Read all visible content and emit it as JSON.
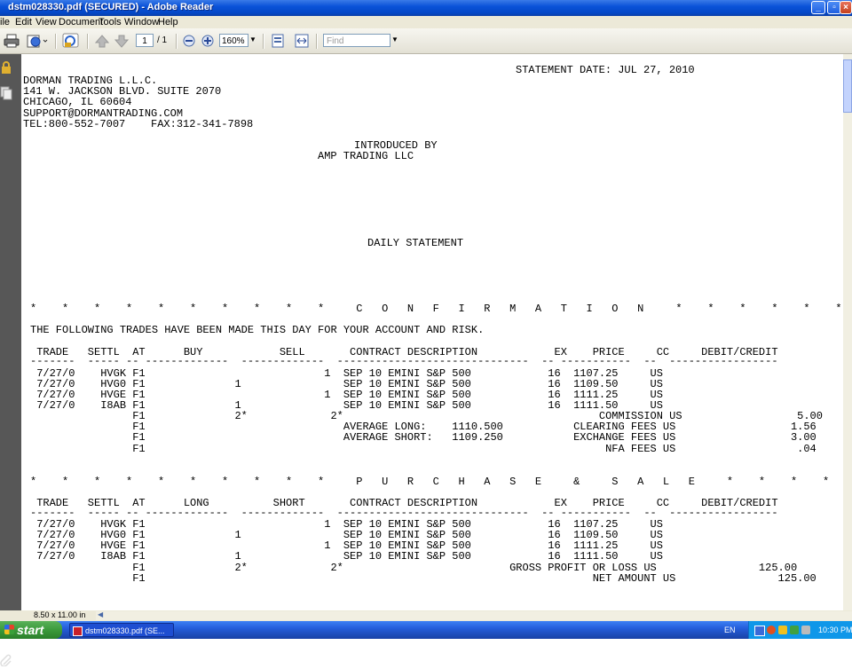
{
  "window": {
    "title": "dstm028330.pdf (SECURED) - Adobe Reader"
  },
  "menu": [
    "ile",
    "Edit",
    "View",
    "Document",
    "Tools",
    "Window",
    "Help"
  ],
  "toolbar": {
    "page_current": "1",
    "page_total": "/ 1",
    "zoom": "160%",
    "find_placeholder": "Find"
  },
  "document": {
    "statement_date": "STATEMENT DATE: JUL 27, 2010",
    "firm": {
      "name": "DORMAN TRADING L.L.C.",
      "address1": "141 W. JACKSON BLVD. SUITE 2070",
      "address2": "CHICAGO, IL 60604",
      "email": "SUPPORT@DORMANTRADING.COM",
      "phones": "TEL:800-552-7007    FAX:312-341-7898"
    },
    "introduced_by_label": "INTRODUCED BY",
    "introduced_by": "AMP TRADING LLC",
    "statement_type": "DAILY STATEMENT",
    "confirmation": {
      "banner": "*    *    *    *    *    *    *    *    *    *     C   O   N   F   I   R   M   A   T   I   O   N     *    *    *    *    *    *    *    *    *    *",
      "intro": "THE FOLLOWING TRADES HAVE BEEN MADE THIS DAY FOR YOUR ACCOUNT AND RISK.",
      "header": " TRADE   SETTL  AT      BUY            SELL       CONTRACT DESCRIPTION            EX    PRICE     CC     DEBIT/CREDIT",
      "rule": "-------  ----- -- -------------  -------------  ------------------------------  -- -----------  --  -----------------",
      "rows": [
        " 7/27/0    HVGK F1                            1  SEP 10 EMINI S&P 500            16  1107.25     US",
        " 7/27/0    HVG0 F1              1                SEP 10 EMINI S&P 500            16  1109.50     US",
        " 7/27/0    HVGE F1                            1  SEP 10 EMINI S&P 500            16  1111.25     US",
        " 7/27/0    I8AB F1              1                SEP 10 EMINI S&P 500            16  1111.50     US",
        "                F1              2*             2*                                        COMMISSION US                  5.00",
        "                F1                               AVERAGE LONG:    1110.500           CLEARING FEES US                  1.56",
        "                F1                               AVERAGE SHORT:   1109.250           EXCHANGE FEES US                  3.00",
        "                F1                                                                        NFA FEES US                   .04"
      ]
    },
    "purchase_sale": {
      "banner": "*    *    *    *    *    *    *    *    *    *     P   U   R   C   H   A   S   E     &     S   A   L   E     *    *    *    *    *    *    *    *    *    *",
      "header": " TRADE   SETTL  AT      LONG          SHORT       CONTRACT DESCRIPTION            EX    PRICE     CC     DEBIT/CREDIT",
      "rule": "-------  ----- -- -------------  -------------  ------------------------------  -- -----------  --  -----------------",
      "rows": [
        " 7/27/0    HVGK F1                            1  SEP 10 EMINI S&P 500            16  1107.25     US",
        " 7/27/0    HVG0 F1              1                SEP 10 EMINI S&P 500            16  1109.50     US",
        " 7/27/0    HVGE F1                            1  SEP 10 EMINI S&P 500            16  1111.25     US",
        " 7/27/0    I8AB F1              1                SEP 10 EMINI S&P 500            16  1111.50     US",
        "                F1              2*             2*                          GROSS PROFIT OR LOSS US                125.00",
        "                F1                                                                      NET AMOUNT US                125.00"
      ]
    }
  },
  "status": {
    "page_size": "8.50 x 11.00 in"
  },
  "taskbar": {
    "start": "start",
    "task_item": "dstm028330.pdf (SE...",
    "lang": "EN",
    "clock": "10:30 PM"
  }
}
